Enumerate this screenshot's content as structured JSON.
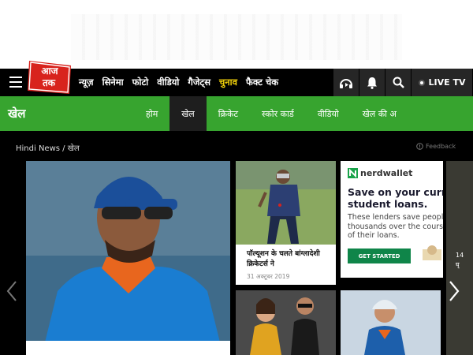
{
  "logo": {
    "text": "आज तक"
  },
  "nav": {
    "links": [
      {
        "label": "न्यूज़",
        "highlight": false
      },
      {
        "label": "सिनेमा",
        "highlight": false
      },
      {
        "label": "फोटो",
        "highlight": false
      },
      {
        "label": "वीडियो",
        "highlight": false
      },
      {
        "label": "गैजेट्स",
        "highlight": false
      },
      {
        "label": "चुनाव",
        "highlight": true
      },
      {
        "label": "फैक्ट चेक",
        "highlight": false
      }
    ],
    "icons": [
      "podcast-icon",
      "bell-icon",
      "search-icon"
    ],
    "live_tv": "LIVE TV"
  },
  "section": {
    "title": "खेल",
    "tabs": [
      {
        "label": "होम",
        "active": false
      },
      {
        "label": "खेल",
        "active": true
      },
      {
        "label": "क्रिकेट",
        "active": false
      },
      {
        "label": "स्कोर कार्ड",
        "active": false
      },
      {
        "label": "वीडियो",
        "active": false
      },
      {
        "label": "खेल की अ",
        "active": false
      }
    ]
  },
  "breadcrumb": {
    "home": "Hindi News",
    "separator": "/",
    "current": "खेल"
  },
  "feedback": "Feedback",
  "cards": {
    "cricket": {
      "headline": "पॉल्यूशन के चलते बांग्लादेशी क्रिकेटर्स ने",
      "date": "31 अक्टूबर 2019"
    },
    "ad": {
      "brand": "nerdwallet",
      "headline_line1": "Save on your curren",
      "headline_line2": "student loans.",
      "body_line1": "These lenders save people",
      "body_line2": "thousands over the cours",
      "body_line3": "of their loans.",
      "cta": "GET STARTED"
    },
    "edge": {
      "line1": "14",
      "line2": "घृ"
    }
  },
  "colors": {
    "accent_green": "#37a42f",
    "highlight_yellow": "#f5d40b",
    "logo_red": "#d8231d",
    "ad_green": "#0f8549"
  }
}
